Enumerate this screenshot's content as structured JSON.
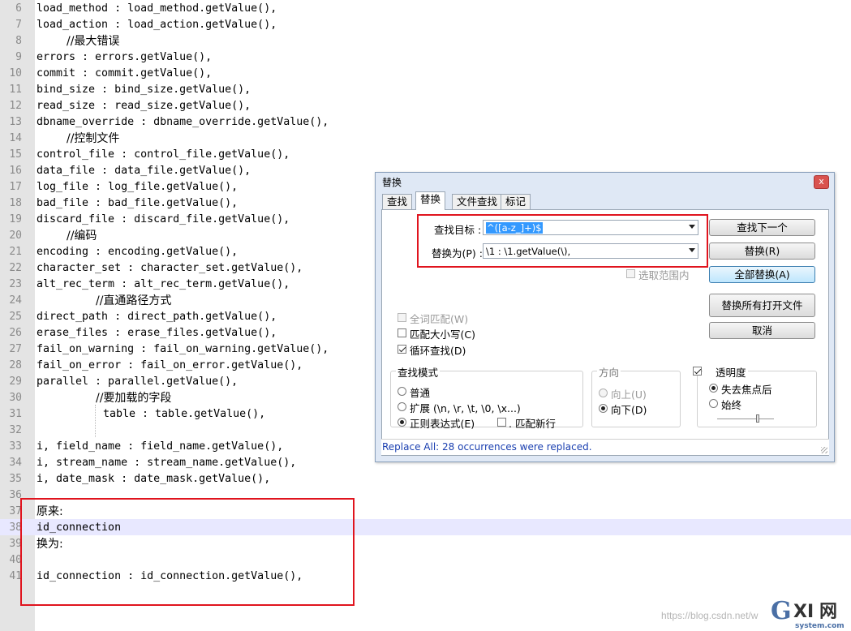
{
  "editor": {
    "lines": [
      {
        "n": "6",
        "text": "load_method : load_method.getValue(),",
        "style": ""
      },
      {
        "n": "7",
        "text": "load_action : load_action.getValue(),",
        "style": ""
      },
      {
        "n": "8",
        "text": "//最大错误",
        "style": "cn indent"
      },
      {
        "n": "9",
        "text": "errors : errors.getValue(),",
        "style": ""
      },
      {
        "n": "10",
        "text": "commit : commit.getValue(),",
        "style": ""
      },
      {
        "n": "11",
        "text": "bind_size : bind_size.getValue(),",
        "style": ""
      },
      {
        "n": "12",
        "text": "read_size : read_size.getValue(),",
        "style": ""
      },
      {
        "n": "13",
        "text": "dbname_override : dbname_override.getValue(),",
        "style": ""
      },
      {
        "n": "14",
        "text": "//控制文件",
        "style": "cn indent"
      },
      {
        "n": "15",
        "text": "control_file : control_file.getValue(),",
        "style": ""
      },
      {
        "n": "16",
        "text": "data_file : data_file.getValue(),",
        "style": ""
      },
      {
        "n": "17",
        "text": "log_file : log_file.getValue(),",
        "style": ""
      },
      {
        "n": "18",
        "text": "bad_file : bad_file.getValue(),",
        "style": ""
      },
      {
        "n": "19",
        "text": "discard_file : discard_file.getValue(),",
        "style": ""
      },
      {
        "n": "20",
        "text": "//编码",
        "style": "cn indent"
      },
      {
        "n": "21",
        "text": "encoding : encoding.getValue(),",
        "style": ""
      },
      {
        "n": "22",
        "text": "character_set : character_set.getValue(),",
        "style": ""
      },
      {
        "n": "23",
        "text": "alt_rec_term : alt_rec_term.getValue(),",
        "style": ""
      },
      {
        "n": "24",
        "text": "//直通路径方式",
        "style": "cn indent2"
      },
      {
        "n": "25",
        "text": "direct_path : direct_path.getValue(),",
        "style": ""
      },
      {
        "n": "26",
        "text": "erase_files : erase_files.getValue(),",
        "style": ""
      },
      {
        "n": "27",
        "text": "fail_on_warning : fail_on_warning.getValue(),",
        "style": ""
      },
      {
        "n": "28",
        "text": "fail_on_error : fail_on_error.getValue(),",
        "style": ""
      },
      {
        "n": "29",
        "text": "parallel : parallel.getValue(),",
        "style": ""
      },
      {
        "n": "30",
        "text": "//要加载的字段",
        "style": "cn indent2"
      },
      {
        "n": "31",
        "text": "table : table.getValue(),",
        "style": "indent3"
      },
      {
        "n": "32",
        "text": "",
        "style": ""
      },
      {
        "n": "33",
        "text": "i, field_name : field_name.getValue(),",
        "style": ""
      },
      {
        "n": "34",
        "text": "i, stream_name : stream_name.getValue(),",
        "style": ""
      },
      {
        "n": "35",
        "text": "i, date_mask : date_mask.getValue(),",
        "style": ""
      },
      {
        "n": "36",
        "text": "",
        "style": ""
      },
      {
        "n": "37",
        "text": "原来:",
        "style": "cn"
      },
      {
        "n": "38",
        "text": "id_connection",
        "style": "hl"
      },
      {
        "n": "39",
        "text": "换为:",
        "style": "cn"
      },
      {
        "n": "40",
        "text": "",
        "style": ""
      },
      {
        "n": "41",
        "text": "id_connection : id_connection.getValue(),",
        "style": ""
      }
    ]
  },
  "dialog": {
    "title": "替换",
    "close_glyph": "x",
    "tabs": [
      "查找",
      "替换",
      "文件查找",
      "标记"
    ],
    "find_label": "查找目标 :",
    "find_value": "^([a-z_]+)$",
    "replace_label": "替换为(P) :",
    "replace_value": "\\1 : \\1.getValue(\\),",
    "in_selection": "选取范围内",
    "buttons": {
      "find_next": "查找下一个",
      "replace": "替换(R)",
      "replace_all": "全部替换(A)",
      "replace_all_open": "替换所有打开文件",
      "cancel": "取消"
    },
    "options": {
      "whole_word": "全词匹配(W)",
      "match_case": "匹配大小写(C)",
      "wrap_around": "循环查找(D)"
    },
    "search_mode": {
      "title": "查找模式",
      "normal": "普通",
      "extended": "扩展 (\\n, \\r, \\t, \\0, \\x...)",
      "regex": "正则表达式(E)",
      "dot_newline": ". 匹配新行"
    },
    "direction": {
      "title": "方向",
      "up": "向上(U)",
      "down": "向下(D)"
    },
    "transparency": {
      "title": "透明度",
      "on_lose_focus": "失去焦点后",
      "always": "始终",
      "level": 0.9
    },
    "status": "Replace All: 28 occurrences were replaced."
  },
  "colors": {
    "highlight_box": "#e0141e",
    "status_text": "#1a3fb0"
  },
  "watermark": {
    "url": "https://blog.csdn.net/w",
    "logo_text": "GXI网",
    "logo_sub": "system.com"
  }
}
